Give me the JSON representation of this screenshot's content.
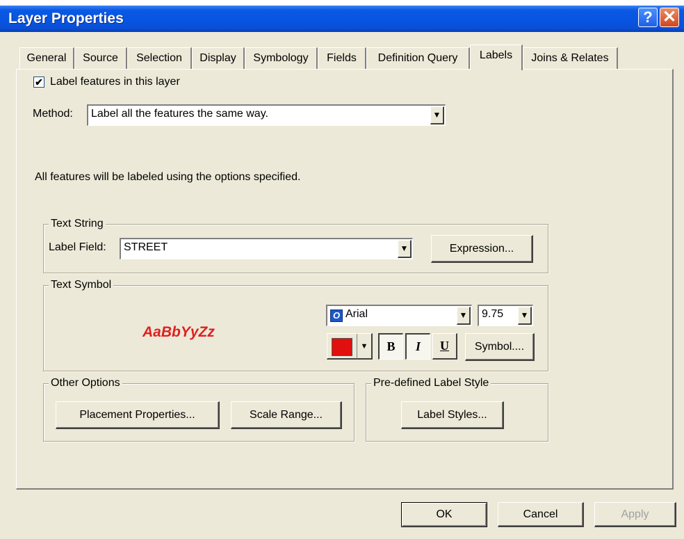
{
  "window": {
    "title": "Layer Properties",
    "help_label": "?",
    "close_label": "✕"
  },
  "tabs": [
    {
      "label": "General"
    },
    {
      "label": "Source"
    },
    {
      "label": "Selection"
    },
    {
      "label": "Display"
    },
    {
      "label": "Symbology"
    },
    {
      "label": "Fields"
    },
    {
      "label": "Definition Query"
    },
    {
      "label": "Labels",
      "active": true
    },
    {
      "label": "Joins & Relates"
    }
  ],
  "labels_tab": {
    "checkbox_label": "Label features in this layer",
    "checkbox_mark": "✔",
    "method_label": "Method:",
    "method_value": "Label all the features the same way.",
    "info_text": "All features will be labeled using the options specified.",
    "text_string": {
      "group_title": "Text String",
      "label_field_label": "Label Field:",
      "label_field_value": "STREET",
      "expression_button": "Expression..."
    },
    "text_symbol": {
      "group_title": "Text Symbol",
      "sample_text": "AaBbYyZz",
      "font_name": "Arial",
      "font_icon": "O",
      "font_size": "9.75",
      "color": "#e20f0f",
      "bold_label": "B",
      "italic_label": "I",
      "underline_label": "U",
      "symbol_button": "Symbol...."
    },
    "other_options": {
      "group_title": "Other Options",
      "placement_button": "Placement Properties...",
      "scale_range_button": "Scale Range..."
    },
    "predefined_style": {
      "group_title": "Pre-defined Label Style",
      "label_styles_button": "Label Styles..."
    }
  },
  "footer": {
    "ok": "OK",
    "cancel": "Cancel",
    "apply": "Apply"
  },
  "arrow_glyph": "▼"
}
